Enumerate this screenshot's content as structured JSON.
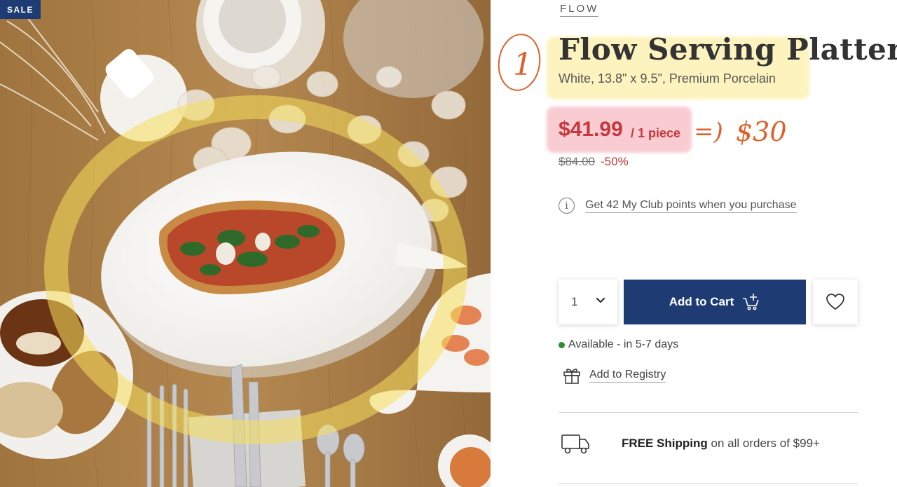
{
  "badge": {
    "sale": "SALE"
  },
  "product": {
    "brand": "FLOW",
    "title": "Flow Serving Platter",
    "subtitle": "White, 13.8\" x 9.5\", Premium Porcelain",
    "price": "$41.99",
    "unit": "/ 1 piece",
    "original_price": "$84.00",
    "discount": "-50%"
  },
  "annotations": {
    "circled_number": "1",
    "arrow": "=)",
    "new_price": "$30",
    "highlight_colors": {
      "yellow": "#fae46e",
      "pink": "#f0788c"
    },
    "ink_color": "#e0602a"
  },
  "points": {
    "text": "Get 42 My Club points when you purchase",
    "icon": "info-icon"
  },
  "purchase": {
    "quantity": "1",
    "add_to_cart": "Add to Cart",
    "cart_icon": "cart-plus-icon",
    "wishlist_icon": "heart-icon"
  },
  "availability": {
    "text": "Available - in 5-7 days",
    "status_color": "#2f8a3a"
  },
  "registry": {
    "label": "Add to Registry",
    "icon": "gift-icon"
  },
  "shipping": {
    "bold": "FREE Shipping",
    "rest": " on all orders of $99+",
    "icon": "truck-icon"
  },
  "colors": {
    "brand_navy": "#1f3b73",
    "sale_red": "#c6383b"
  }
}
